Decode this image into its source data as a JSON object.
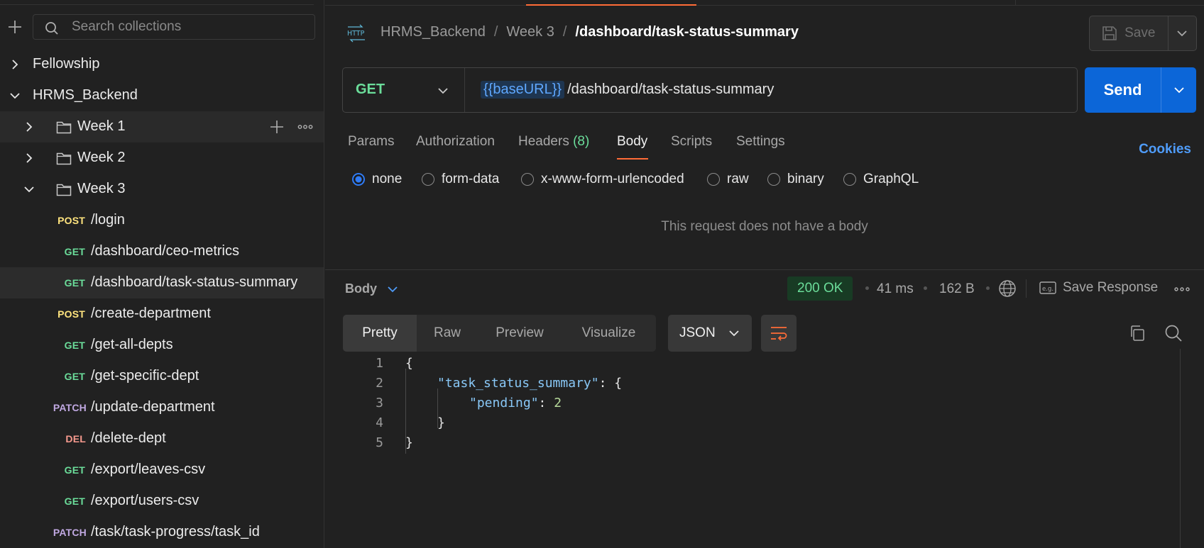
{
  "sidebar": {
    "search_placeholder": "Search collections",
    "collections": [
      {
        "label": "Fellowship"
      },
      {
        "label": "HRMS_Backend"
      }
    ],
    "folders": [
      {
        "label": "Week 1"
      },
      {
        "label": "Week 2"
      },
      {
        "label": "Week 3"
      }
    ],
    "requests": [
      {
        "method": "POST",
        "label": "/login"
      },
      {
        "method": "GET",
        "label": "/dashboard/ceo-metrics"
      },
      {
        "method": "GET",
        "label": "/dashboard/task-status-summary"
      },
      {
        "method": "POST",
        "label": "/create-department"
      },
      {
        "method": "GET",
        "label": "/get-all-depts"
      },
      {
        "method": "GET",
        "label": "/get-specific-dept"
      },
      {
        "method": "PATCH",
        "label": "/update-department"
      },
      {
        "method": "DEL",
        "label": "/delete-dept"
      },
      {
        "method": "GET",
        "label": "/export/leaves-csv"
      },
      {
        "method": "GET",
        "label": "/export/users-csv"
      },
      {
        "method": "PATCH",
        "label": "/task/task-progress/task_id"
      }
    ]
  },
  "header": {
    "http_icon_label": "HTTP",
    "breadcrumb": [
      "HRMS_Backend",
      "Week 3"
    ],
    "breadcrumb_sep": "/",
    "current": "/dashboard/task-status-summary",
    "save_label": "Save"
  },
  "request": {
    "method": "GET",
    "url_variable": "{{baseURL}}",
    "url_path": "/dashboard/task-status-summary",
    "send_label": "Send"
  },
  "request_tabs": {
    "params": "Params",
    "authorization": "Authorization",
    "headers": "Headers",
    "headers_count": "(8)",
    "body": "Body",
    "scripts": "Scripts",
    "settings": "Settings",
    "cookies": "Cookies"
  },
  "body_options": {
    "none": "none",
    "form_data": "form-data",
    "urlencoded": "x-www-form-urlencoded",
    "raw": "raw",
    "binary": "binary",
    "graphql": "GraphQL",
    "selected": "none",
    "empty_message": "This request does not have a body"
  },
  "response": {
    "section_label": "Body",
    "status": "200 OK",
    "time": "41 ms",
    "size": "162 B",
    "save_response_label": "Save Response",
    "view_tabs": {
      "pretty": "Pretty",
      "raw": "Raw",
      "preview": "Preview",
      "visualize": "Visualize"
    },
    "format": "JSON",
    "lines": [
      {
        "no": "1",
        "text": "{"
      },
      {
        "no": "2",
        "key": "\"task_status_summary\"",
        "rest": ": {"
      },
      {
        "no": "3",
        "key": "\"pending\"",
        "rest": ": ",
        "num": "2"
      },
      {
        "no": "4",
        "text": "}"
      },
      {
        "no": "5",
        "text": "}"
      }
    ]
  },
  "colors": {
    "accent": "#ff6c37",
    "send_blue": "#0c66d8",
    "get_green": "#6bdd9a",
    "post_yellow": "#ffe47e",
    "patch_purple": "#c0a8e1",
    "del_red": "#f79a8e"
  }
}
